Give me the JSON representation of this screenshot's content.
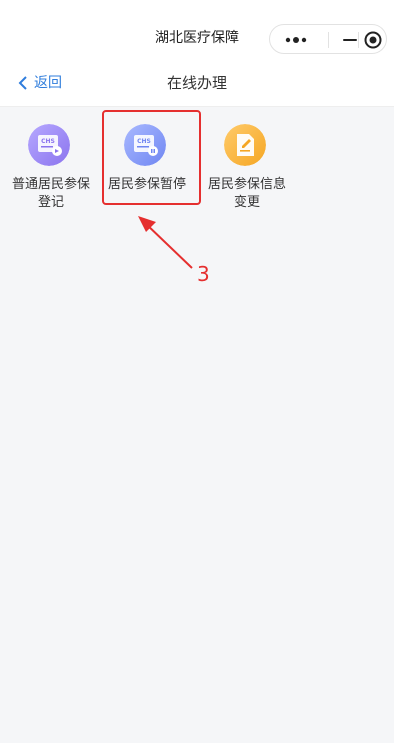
{
  "app": {
    "title": "湖北医疗保障"
  },
  "nav": {
    "back_label": "返回",
    "title": "在线办理"
  },
  "tiles": [
    {
      "label_line1": "普通居民参保",
      "label_line2": "登记",
      "icon": "insurance-card-register-icon"
    },
    {
      "label_line1": "居民参保暂停",
      "label_line2": "",
      "icon": "insurance-card-pause-icon"
    },
    {
      "label_line1": "居民参保信息",
      "label_line2": "变更",
      "icon": "document-edit-icon"
    }
  ],
  "annotation": {
    "number": "3",
    "color": "#e52f2f"
  },
  "colors": {
    "accent": "#2f7ddc",
    "purple": "#8f7cf0",
    "blue": "#6f8ff0",
    "orange": "#f5a623"
  }
}
